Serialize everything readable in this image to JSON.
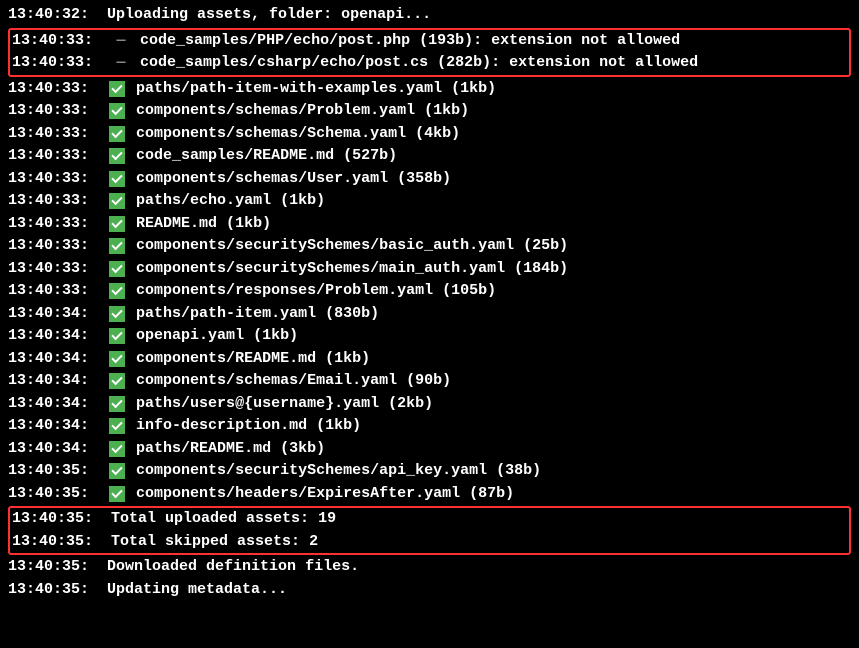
{
  "lines": [
    {
      "ts": "13:40:32:",
      "icon": "none",
      "msg": "Uploading assets, folder: openapi..."
    }
  ],
  "box1": [
    {
      "ts": "13:40:33:",
      "icon": "dash",
      "msg": "code_samples/PHP/echo/post.php (193b): extension not allowed"
    },
    {
      "ts": "13:40:33:",
      "icon": "dash",
      "msg": "code_samples/csharp/echo/post.cs (282b): extension not allowed"
    }
  ],
  "mid": [
    {
      "ts": "13:40:33:",
      "icon": "check",
      "msg": "paths/path-item-with-examples.yaml (1kb)"
    },
    {
      "ts": "13:40:33:",
      "icon": "check",
      "msg": "components/schemas/Problem.yaml (1kb)"
    },
    {
      "ts": "13:40:33:",
      "icon": "check",
      "msg": "components/schemas/Schema.yaml (4kb)"
    },
    {
      "ts": "13:40:33:",
      "icon": "check",
      "msg": "code_samples/README.md (527b)"
    },
    {
      "ts": "13:40:33:",
      "icon": "check",
      "msg": "components/schemas/User.yaml (358b)"
    },
    {
      "ts": "13:40:33:",
      "icon": "check",
      "msg": "paths/echo.yaml (1kb)"
    },
    {
      "ts": "13:40:33:",
      "icon": "check",
      "msg": "README.md (1kb)"
    },
    {
      "ts": "13:40:33:",
      "icon": "check",
      "msg": "components/securitySchemes/basic_auth.yaml (25b)"
    },
    {
      "ts": "13:40:33:",
      "icon": "check",
      "msg": "components/securitySchemes/main_auth.yaml (184b)"
    },
    {
      "ts": "13:40:33:",
      "icon": "check",
      "msg": "components/responses/Problem.yaml (105b)"
    },
    {
      "ts": "13:40:34:",
      "icon": "check",
      "msg": "paths/path-item.yaml (830b)"
    },
    {
      "ts": "13:40:34:",
      "icon": "check",
      "msg": "openapi.yaml (1kb)"
    },
    {
      "ts": "13:40:34:",
      "icon": "check",
      "msg": "components/README.md (1kb)"
    },
    {
      "ts": "13:40:34:",
      "icon": "check",
      "msg": "components/schemas/Email.yaml (90b)"
    },
    {
      "ts": "13:40:34:",
      "icon": "check",
      "msg": "paths/users@{username}.yaml (2kb)"
    },
    {
      "ts": "13:40:34:",
      "icon": "check",
      "msg": "info-description.md (1kb)"
    },
    {
      "ts": "13:40:34:",
      "icon": "check",
      "msg": "paths/README.md (3kb)"
    },
    {
      "ts": "13:40:35:",
      "icon": "check",
      "msg": "components/securitySchemes/api_key.yaml (38b)"
    },
    {
      "ts": "13:40:35:",
      "icon": "check",
      "msg": "components/headers/ExpiresAfter.yaml (87b)"
    }
  ],
  "box2": [
    {
      "ts": "13:40:35:",
      "icon": "none",
      "msg": "Total uploaded assets: 19"
    },
    {
      "ts": "13:40:35:",
      "icon": "none",
      "msg": "Total skipped assets: 2"
    }
  ],
  "tail": [
    {
      "ts": "13:40:35:",
      "icon": "none",
      "msg": "Downloaded definition files."
    },
    {
      "ts": "13:40:35:",
      "icon": "none",
      "msg": "Updating metadata..."
    }
  ]
}
